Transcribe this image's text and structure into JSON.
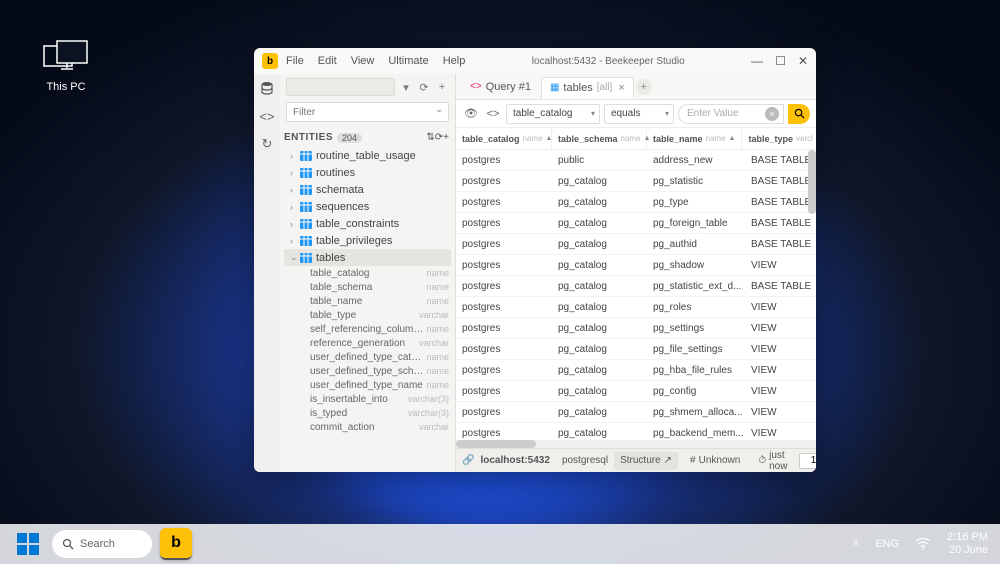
{
  "desktop": {
    "this_pc": "This PC"
  },
  "taskbar": {
    "search": "Search",
    "lang": "ENG",
    "time": "2:16 PM",
    "date": "20 June"
  },
  "window": {
    "title": "localhost:5432 - Beekeeper Studio",
    "menus": [
      "File",
      "Edit",
      "View",
      "Ultimate",
      "Help"
    ],
    "filter_placeholder": "Filter",
    "entities_label": "ENTITIES",
    "entities_count": "204",
    "tree": [
      {
        "name": "routine_table_usage",
        "expanded": false
      },
      {
        "name": "routines",
        "expanded": false
      },
      {
        "name": "schemata",
        "expanded": false
      },
      {
        "name": "sequences",
        "expanded": false
      },
      {
        "name": "table_constraints",
        "expanded": false
      },
      {
        "name": "table_privileges",
        "expanded": false
      },
      {
        "name": "tables",
        "expanded": true,
        "selected": true
      }
    ],
    "columns": [
      {
        "name": "table_catalog",
        "type": "name"
      },
      {
        "name": "table_schema",
        "type": "name"
      },
      {
        "name": "table_name",
        "type": "name"
      },
      {
        "name": "table_type",
        "type": "varchar"
      },
      {
        "name": "self_referencing_column...",
        "type": "name"
      },
      {
        "name": "reference_generation",
        "type": "varchar"
      },
      {
        "name": "user_defined_type_catalog",
        "type": "name"
      },
      {
        "name": "user_defined_type_sche...",
        "type": "name"
      },
      {
        "name": "user_defined_type_name",
        "type": "name"
      },
      {
        "name": "is_insertable_into",
        "type": "varchar(3)"
      },
      {
        "name": "is_typed",
        "type": "varchar(3)"
      },
      {
        "name": "commit_action",
        "type": "varchar"
      }
    ],
    "tabs": {
      "query": "Query #1",
      "tables": "tables",
      "tables_dim": "[all]"
    },
    "filter": {
      "col": "table_catalog",
      "op": "equals",
      "placeholder": "Enter Value"
    },
    "headers": [
      {
        "name": "table_catalog",
        "type": "name"
      },
      {
        "name": "table_schema",
        "type": "name"
      },
      {
        "name": "table_name",
        "type": "name"
      },
      {
        "name": "table_type",
        "type": "varcl"
      }
    ],
    "rows": [
      {
        "c0": "postgres",
        "c1": "public",
        "c2": "address_new",
        "c3": "BASE TABLE"
      },
      {
        "c0": "postgres",
        "c1": "pg_catalog",
        "c2": "pg_statistic",
        "c3": "BASE TABLE"
      },
      {
        "c0": "postgres",
        "c1": "pg_catalog",
        "c2": "pg_type",
        "c3": "BASE TABLE"
      },
      {
        "c0": "postgres",
        "c1": "pg_catalog",
        "c2": "pg_foreign_table",
        "c3": "BASE TABLE"
      },
      {
        "c0": "postgres",
        "c1": "pg_catalog",
        "c2": "pg_authid",
        "c3": "BASE TABLE"
      },
      {
        "c0": "postgres",
        "c1": "pg_catalog",
        "c2": "pg_shadow",
        "c3": "VIEW"
      },
      {
        "c0": "postgres",
        "c1": "pg_catalog",
        "c2": "pg_statistic_ext_d...",
        "c3": "BASE TABLE"
      },
      {
        "c0": "postgres",
        "c1": "pg_catalog",
        "c2": "pg_roles",
        "c3": "VIEW"
      },
      {
        "c0": "postgres",
        "c1": "pg_catalog",
        "c2": "pg_settings",
        "c3": "VIEW"
      },
      {
        "c0": "postgres",
        "c1": "pg_catalog",
        "c2": "pg_file_settings",
        "c3": "VIEW"
      },
      {
        "c0": "postgres",
        "c1": "pg_catalog",
        "c2": "pg_hba_file_rules",
        "c3": "VIEW"
      },
      {
        "c0": "postgres",
        "c1": "pg_catalog",
        "c2": "pg_config",
        "c3": "VIEW"
      },
      {
        "c0": "postgres",
        "c1": "pg_catalog",
        "c2": "pg_shmem_alloca...",
        "c3": "VIEW"
      },
      {
        "c0": "postgres",
        "c1": "pg_catalog",
        "c2": "pg_backend_mem...",
        "c3": "VIEW"
      }
    ],
    "status": {
      "conn": "localhost:5432",
      "driver": "postgresql",
      "structure": "Structure",
      "unknown": "Unknown",
      "justnow": "just now",
      "page": "1"
    }
  }
}
